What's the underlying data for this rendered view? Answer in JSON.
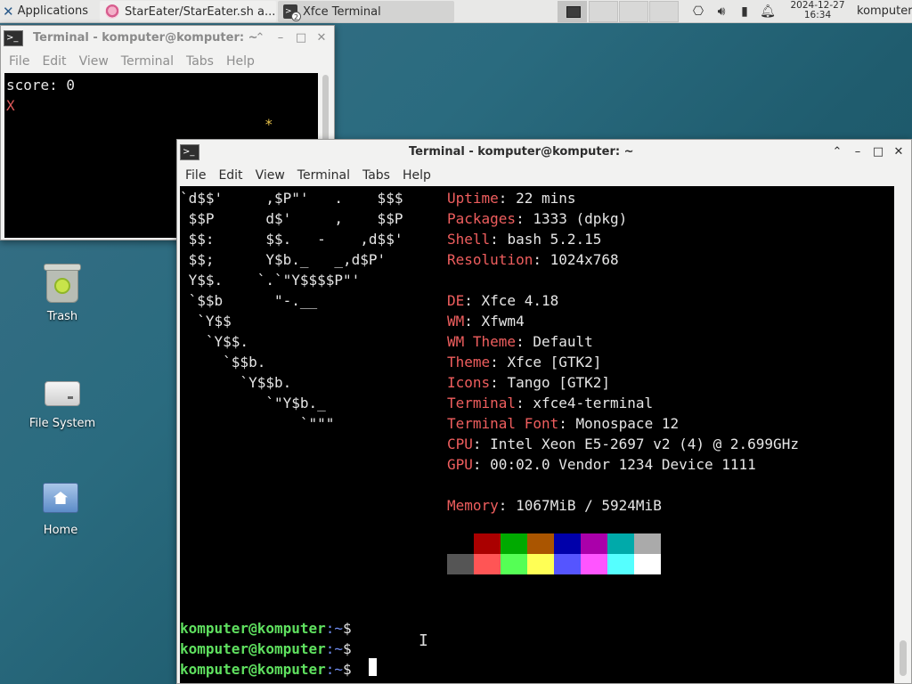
{
  "panel": {
    "applications_label": "Applications",
    "tasks": [
      {
        "label": "StarEater/StarEater.sh a..."
      },
      {
        "label": "Xfce Terminal",
        "badge": "2"
      }
    ],
    "clock_date": "2024-12-27",
    "clock_time": "16:34",
    "username": "komputer"
  },
  "desktop": {
    "icons": [
      {
        "label": "Trash"
      },
      {
        "label": "File System"
      },
      {
        "label": "Home"
      }
    ]
  },
  "window_bg": {
    "title": "Terminal - komputer@komputer: ~",
    "menu": [
      "File",
      "Edit",
      "View",
      "Terminal",
      "Tabs",
      "Help"
    ],
    "score_line": "score: 0",
    "player_char": "X",
    "star_char": "*"
  },
  "window_fg": {
    "title": "Terminal - komputer@komputer: ~",
    "menu": [
      "File",
      "Edit",
      "View",
      "Terminal",
      "Tabs",
      "Help"
    ],
    "logo": {
      "line1": "`d$$'     ,$P\"'   .    $$$",
      "line2": " $$P      d$'     ,    $$P",
      "line3": " $$:      $$.   -    ,d$$'",
      "line4": " $$;      Y$b._   _,d$P'",
      "line5": " Y$$.    `.`\"Y$$$$P\"'",
      "line6": " `$$b      \"-.__",
      "line7": "  `Y$$",
      "line8": "   `Y$$.",
      "line9": "     `$$b.",
      "line10": "       `Y$$b.",
      "line11": "          `\"Y$b._",
      "line12": "              `\"\"\""
    },
    "info": [
      {
        "key": "Uptime",
        "value": "22 mins"
      },
      {
        "key": "Packages",
        "value": "1333 (dpkg)"
      },
      {
        "key": "Shell",
        "value": "bash 5.2.15"
      },
      {
        "key": "Resolution",
        "value": "1024x768"
      },
      {
        "key": "DE",
        "value": "Xfce 4.18"
      },
      {
        "key": "WM",
        "value": "Xfwm4"
      },
      {
        "key": "WM Theme",
        "value": "Default"
      },
      {
        "key": "Theme",
        "value": "Xfce [GTK2]"
      },
      {
        "key": "Icons",
        "value": "Tango [GTK2]"
      },
      {
        "key": "Terminal",
        "value": "xfce4-terminal"
      },
      {
        "key": "Terminal Font",
        "value": "Monospace 12"
      },
      {
        "key": "CPU",
        "value": "Intel Xeon E5-2697 v2 (4) @ 2.699GHz"
      },
      {
        "key": "GPU",
        "value": "00:02.0 Vendor 1234 Device 1111"
      },
      {
        "key": "Memory",
        "value": "1067MiB / 5924MiB"
      }
    ],
    "palette_top": [
      "#000000",
      "#aa0000",
      "#00aa00",
      "#aa5500",
      "#0000aa",
      "#aa00aa",
      "#00aaaa",
      "#aaaaaa"
    ],
    "palette_bottom": [
      "#555555",
      "#ff5555",
      "#55ff55",
      "#ffff55",
      "#5555ff",
      "#ff55ff",
      "#55ffff",
      "#ffffff"
    ],
    "prompt_user": "komputer@komputer",
    "prompt_path": ":~",
    "prompt_symbol": "$"
  }
}
